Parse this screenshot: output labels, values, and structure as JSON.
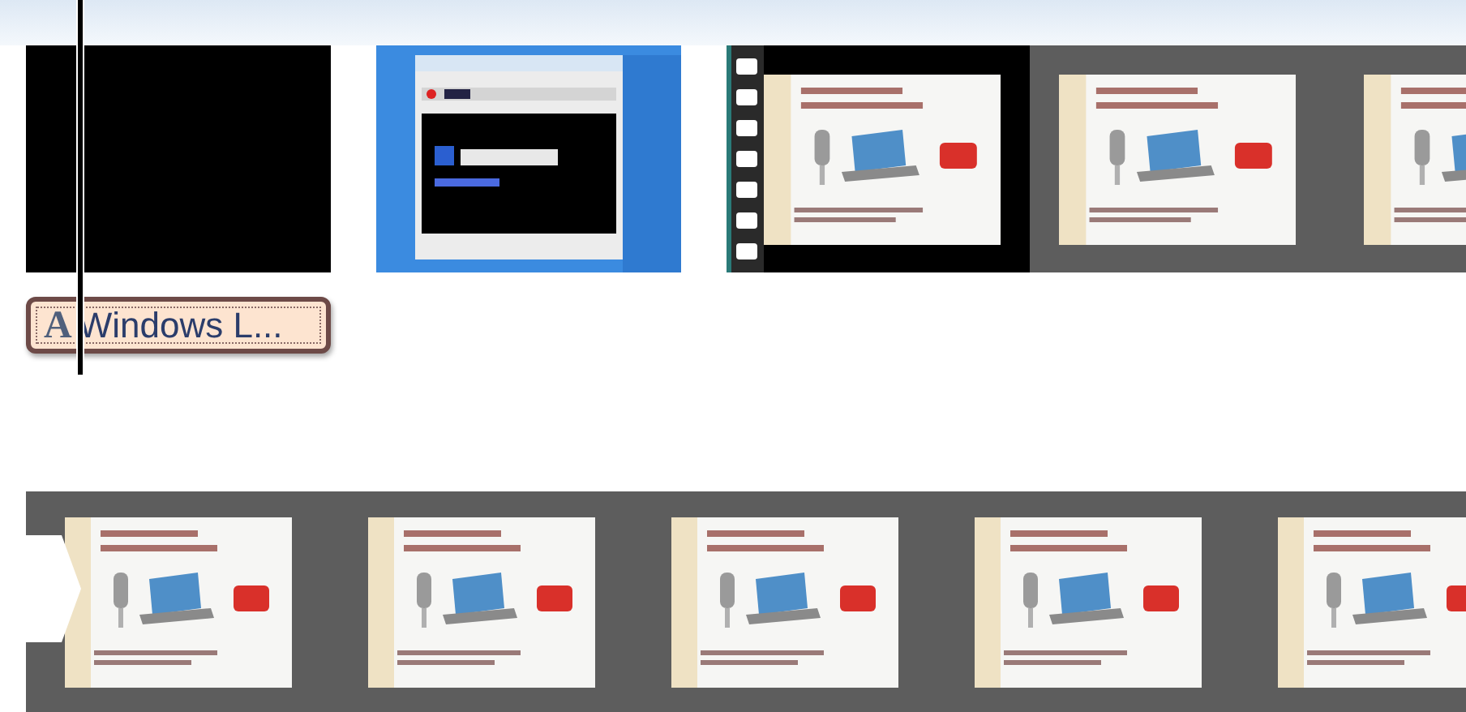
{
  "tracks": [
    {
      "clips": [
        {
          "kind": "black",
          "caption": {
            "icon": "A",
            "text": "Windows L..."
          }
        },
        {
          "kind": "picture"
        },
        {
          "kind": "film-strip",
          "frames": [
            {
              "kind": "picture"
            },
            {
              "kind": "picture"
            },
            {
              "kind": "picture"
            }
          ]
        }
      ]
    },
    {
      "clips": [
        {
          "kind": "arrow-strip",
          "frames": [
            {
              "kind": "picture"
            },
            {
              "kind": "picture"
            },
            {
              "kind": "picture"
            },
            {
              "kind": "picture"
            },
            {
              "kind": "picture"
            }
          ]
        }
      ]
    }
  ]
}
